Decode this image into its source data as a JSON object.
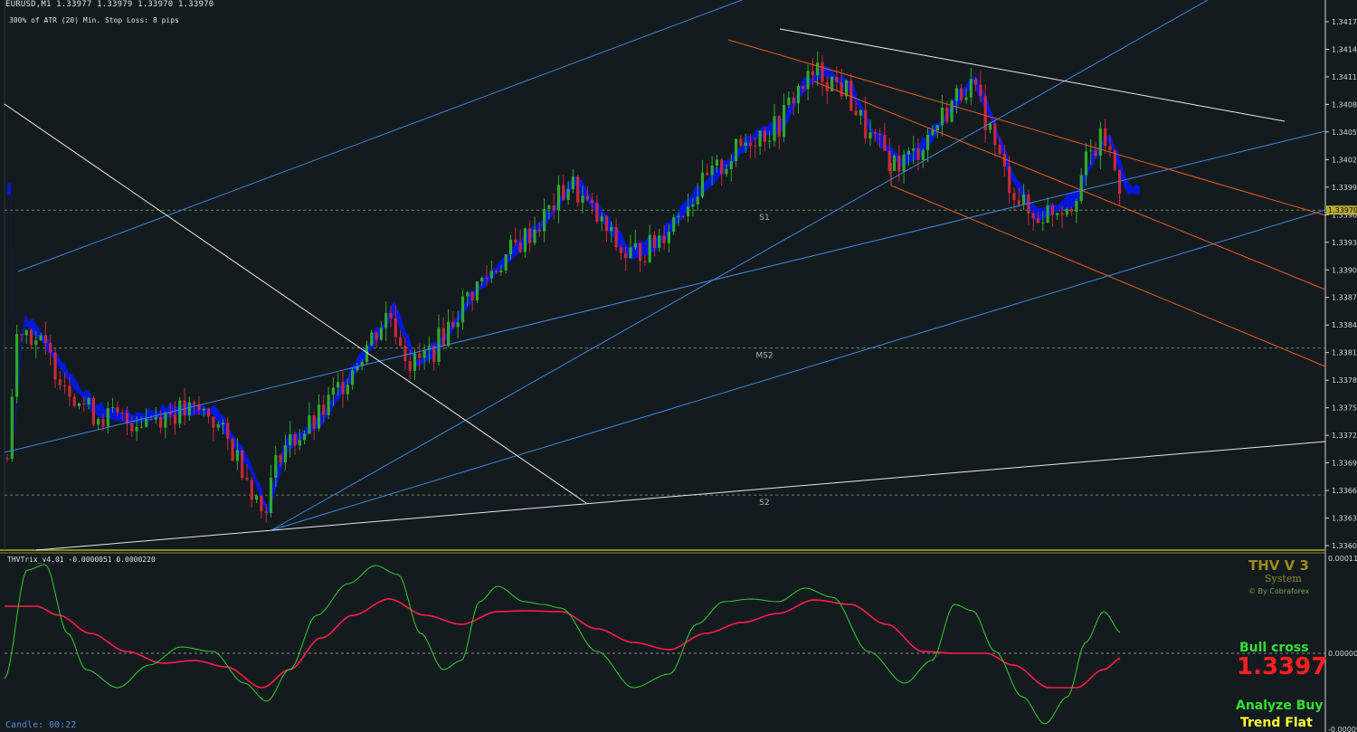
{
  "header": {
    "symbol_line": "EURUSD,M1  1.33977 1.33979 1.33970 1.33970",
    "atr_line": "300% of ATR (20)      Min. Stop Loss:   8 pips"
  },
  "price_axis": {
    "labels": [
      "1.34175",
      "1.34145",
      "1.34115",
      "1.34085",
      "1.34055",
      "1.34025",
      "1.33995",
      "1.33965",
      "1.33935",
      "1.33905",
      "1.33875",
      "1.33845",
      "1.33815",
      "1.33785",
      "1.33755",
      "1.33725",
      "1.33695",
      "1.33665",
      "1.33635",
      "1.33605"
    ],
    "current_price": "1.33970"
  },
  "levels": [
    {
      "name": "S1",
      "price": 1.3397
    },
    {
      "name": "MS2",
      "price": 1.3382
    },
    {
      "name": "S2",
      "price": 1.3366
    }
  ],
  "indicator": {
    "title": "THVTrix_v4.01 -0.0000051 0.0000220",
    "axis_labels": [
      "0.000119",
      "0.0000000",
      "-0.000091"
    ]
  },
  "panel": {
    "title": "THV V 3",
    "subtitle": "System",
    "byline": "© By Cobraforex",
    "signal": "Bull cross",
    "price": "1.3397",
    "analyze": "Analyze Buy",
    "trend": "Trend Flat"
  },
  "footer": {
    "candle_timer": "Candle:  00:22"
  },
  "colors": {
    "background": "#141b1f",
    "bull_candle": "#2ea82e",
    "bear_candle": "#c8283c",
    "cloud": "#0018e6",
    "channel_blue": "#3a86d8",
    "channel_orange": "#e05a1e",
    "trendline": "#e8e8e8",
    "separator": "#8a8a20"
  }
}
